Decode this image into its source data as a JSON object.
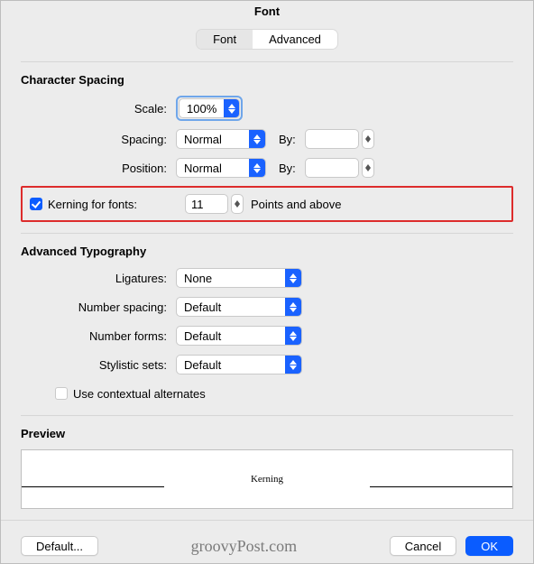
{
  "window": {
    "title": "Font"
  },
  "tabs": {
    "font": "Font",
    "advanced": "Advanced"
  },
  "character_spacing": {
    "title": "Character Spacing",
    "scale_label": "Scale:",
    "scale_value": "100%",
    "spacing_label": "Spacing:",
    "spacing_value": "Normal",
    "spacing_by_label": "By:",
    "spacing_by_value": "",
    "position_label": "Position:",
    "position_value": "Normal",
    "position_by_label": "By:",
    "position_by_value": "",
    "kerning_label": "Kerning for fonts:",
    "kerning_value": "11",
    "kerning_suffix": "Points and above"
  },
  "advanced_typography": {
    "title": "Advanced Typography",
    "ligatures_label": "Ligatures:",
    "ligatures_value": "None",
    "number_spacing_label": "Number spacing:",
    "number_spacing_value": "Default",
    "number_forms_label": "Number forms:",
    "number_forms_value": "Default",
    "stylistic_sets_label": "Stylistic sets:",
    "stylistic_sets_value": "Default",
    "contextual_label": "Use contextual alternates"
  },
  "preview": {
    "title": "Preview",
    "sample": "Kerning"
  },
  "footer": {
    "default": "Default...",
    "cancel": "Cancel",
    "ok": "OK",
    "watermark": "groovyPost.com"
  }
}
